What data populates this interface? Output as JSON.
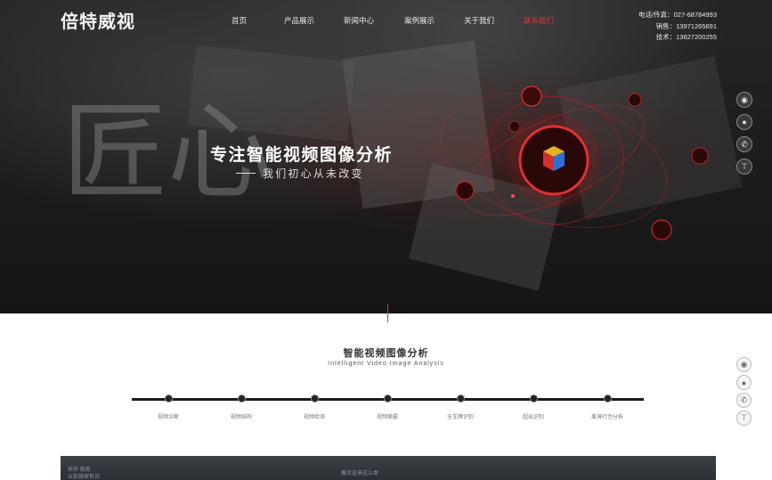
{
  "brand": {
    "logo_text": "倍特威视"
  },
  "nav": {
    "items": [
      {
        "label": "首页"
      },
      {
        "label": "产品展示"
      },
      {
        "label": "新闻中心"
      },
      {
        "label": "案例展示"
      },
      {
        "label": "关于我们"
      },
      {
        "label": "联系我们"
      }
    ],
    "active_index": 5
  },
  "contact": {
    "line1": "电话/传真：027-68784993",
    "line2": "销售：13971265691",
    "line3": "技术：13627200255"
  },
  "hero": {
    "watermark": "匠心",
    "headline": "专注智能视频图像分析",
    "subline": "我们初心从未改变"
  },
  "section": {
    "title": "智能视频图像分析",
    "subtitle": "Intelligent Video Image Analysis"
  },
  "timeline": {
    "items": [
      {
        "label": "视频诊断"
      },
      {
        "label": "视频结构"
      },
      {
        "label": "视频检测"
      },
      {
        "label": "视频摘要"
      },
      {
        "label": "全车牌识别"
      },
      {
        "label": "超出识别"
      },
      {
        "label": "离境行为分析"
      }
    ]
  },
  "bottom_banner": {
    "left_text_1": "天华 南南",
    "left_text_2": "以前银家有识",
    "center_text": "像见证来这么本"
  },
  "side_tools": {
    "icons": [
      "wechat-icon",
      "chat-icon",
      "phone-icon",
      "top-icon"
    ]
  },
  "colors": {
    "accent": "#e0312d",
    "hero_bg": "#1e1e1e"
  }
}
